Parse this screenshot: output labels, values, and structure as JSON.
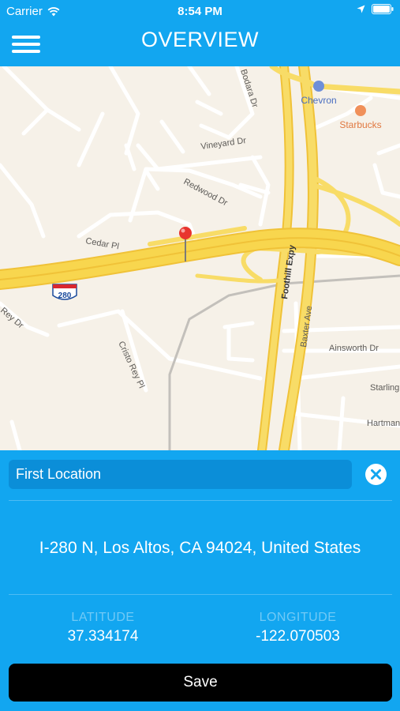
{
  "status_bar": {
    "carrier": "Carrier",
    "time": "8:54 PM"
  },
  "nav": {
    "title": "OVERVIEW"
  },
  "map": {
    "labels": {
      "chevron": "Chevron",
      "starbucks": "Starbucks",
      "vineyard": "Vineyard Dr",
      "redwood": "Redwood Dr",
      "bodara": "Bodara Dr",
      "cedar": "Cedar Pl",
      "highway_shield": "280",
      "foothill": "Foothill Expy",
      "baxter": "Baxter Ave",
      "ainsworth": "Ainsworth Dr",
      "starling": "Starling",
      "hartman": "Hartman",
      "rey": "Rey Dr",
      "cristo_rey": "Cristo Rey Pl"
    }
  },
  "location": {
    "name_value": "First Location",
    "address": "I-280 N, Los Altos, CA  94024, United States",
    "latitude_label": "LATITUDE",
    "latitude_value": "37.334174",
    "longitude_label": "LONGITUDE",
    "longitude_value": "-122.070503"
  },
  "actions": {
    "save_label": "Save"
  },
  "colors": {
    "accent": "#12a6f0",
    "field": "#0b8ed8",
    "button": "#000000"
  }
}
